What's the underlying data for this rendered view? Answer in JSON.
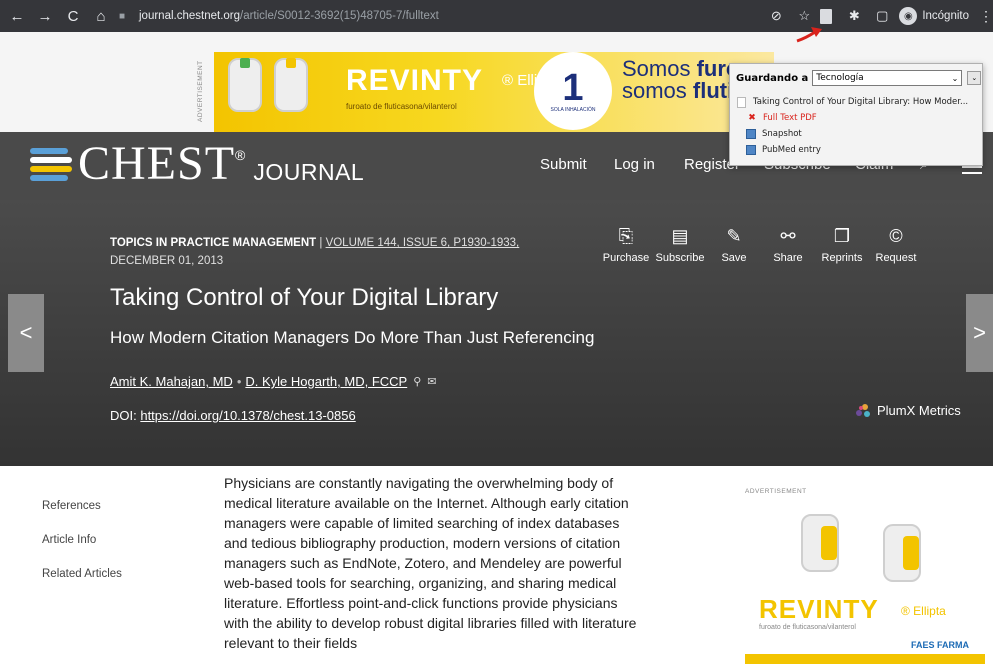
{
  "browser": {
    "url_host": "journal.chestnet.org",
    "url_path": "/article/S0012-3692(15)48705-7/fulltext",
    "profile_label": "Incógnito"
  },
  "banner_ad": {
    "label": "ADVERTISEMENT",
    "brand": "REVINTY",
    "product_suffix": "® Ellipta",
    "drug": "furoato de fluticasona/vilanterol",
    "circle_number": "1",
    "circle_caption": "SOLA INHALACIÓN",
    "tagline_prefix_1": "Somos ",
    "tagline_bold_1": "furoa",
    "tagline_prefix_2": "somos ",
    "tagline_bold_2": "flutic"
  },
  "journal": {
    "logo_main": "CHEST",
    "logo_sub": "JOURNAL",
    "logo_reg": "®",
    "nav": [
      "Submit",
      "Log in",
      "Register",
      "Subscribe",
      "Claim"
    ]
  },
  "article": {
    "topic": "TOPICS IN PRACTICE MANAGEMENT",
    "separator": " | ",
    "volume": "VOLUME 144, ISSUE 6, P1930-1933,",
    "date": "DECEMBER 01, 2013",
    "title": "Taking Control of Your Digital Library",
    "subtitle": "How Modern Citation Managers Do More Than Just Referencing",
    "author1": "Amit K. Mahajan, MD",
    "author2": "D. Kyle Hogarth, MD, FCCP",
    "doi_label": "DOI: ",
    "doi_link": "https://doi.org/10.1378/chest.13-0856",
    "plumx": "PlumX Metrics",
    "actions": [
      {
        "label": "Purchase",
        "icon": "pdf-icon"
      },
      {
        "label": "Subscribe",
        "icon": "journal-icon"
      },
      {
        "label": "Save",
        "icon": "save-icon"
      },
      {
        "label": "Share",
        "icon": "share-icon"
      },
      {
        "label": "Reprints",
        "icon": "reprints-icon"
      },
      {
        "label": "Request",
        "icon": "copyright-icon"
      }
    ]
  },
  "left_nav": [
    "References",
    "Article Info",
    "Related Articles"
  ],
  "abstract": "Physicians are constantly navigating the overwhelming body of medical literature available on the Internet. Although early citation managers were capable of limited searching of index databases and tedious bibliography production, modern versions of citation managers such as EndNote, Zotero, and Mendeley are powerful web-based tools for searching, organizing, and sharing medical literature. Effortless point-and-click functions provide physicians with the ability to develop robust digital libraries filled with literature relevant to their fields",
  "side_ad": {
    "label": "ADVERTISEMENT",
    "brand": "REVINTY",
    "product_suffix": "® Ellipta",
    "drug": "furoato de fluticasona/vilanterol",
    "company": "FAES FARMA"
  },
  "zotero": {
    "saving_to": "Guardando a",
    "collection": "Tecnología",
    "item_title": "Taking Control of Your Digital Library: How Moder...",
    "attachments": [
      "Full Text PDF",
      "Snapshot",
      "PubMed entry"
    ]
  },
  "colors": {
    "toolbar": "#35363a",
    "header": "#4a4a4a",
    "ad_yellow": "#f3c400",
    "error_red": "#d9231c"
  }
}
